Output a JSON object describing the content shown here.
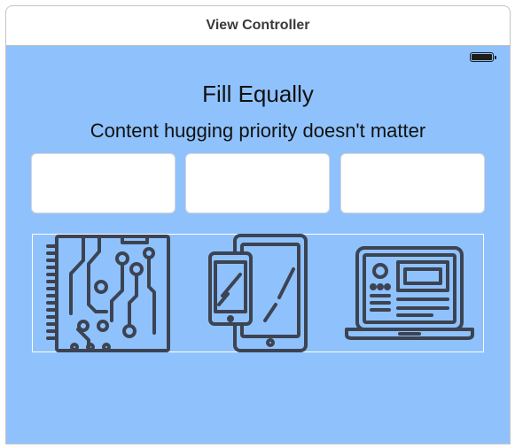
{
  "window": {
    "title": "View Controller"
  },
  "status": {
    "battery_icon": "battery-icon"
  },
  "content": {
    "heading": "Fill Equally",
    "subheading": "Content hugging priority doesn't matter"
  },
  "text_fields": [
    {
      "value": ""
    },
    {
      "value": ""
    },
    {
      "value": ""
    }
  ],
  "images": [
    {
      "icon": "circuit-board-icon"
    },
    {
      "icon": "phone-tablet-icon"
    },
    {
      "icon": "laptop-icon"
    }
  ],
  "colors": {
    "background": "#8fc2fc",
    "icon_stroke": "#3c4352"
  }
}
